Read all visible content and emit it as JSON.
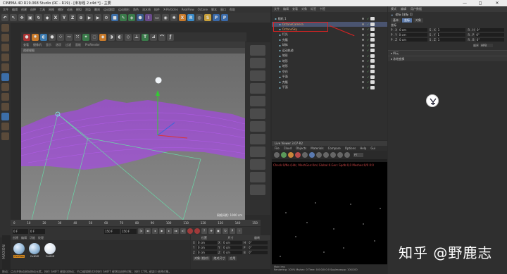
{
  "window": {
    "title": "CINEMA 4D R19.068 Studio (RC - R19) - [未标题 2.c4d *] - 主要",
    "min": "—",
    "max": "◻",
    "close": "✕"
  },
  "menubar": [
    "文件",
    "编辑",
    "创建",
    "选择",
    "工具",
    "网格",
    "捕捉",
    "动画",
    "模拟",
    "渲染",
    "雕刻",
    "运动跟踪",
    "运动图形",
    "角色",
    "流水线",
    "插件",
    "X-Particles",
    "RealFlow",
    "Octane",
    "脚本",
    "窗口",
    "帮助"
  ],
  "toolbar": {
    "axes": [
      "X",
      "Y",
      "Z"
    ],
    "layout_label": "界面:",
    "layout_value": "Octane (用户)"
  },
  "viewport": {
    "menu": [
      "查看",
      "摄像机",
      "显示",
      "选项",
      "过滤",
      "面板",
      "ProRender"
    ],
    "label": "透视视图",
    "grid_scale": "网格间距: 1000 cm"
  },
  "timeline": {
    "ticks": [
      "0",
      "10",
      "20",
      "30",
      "40",
      "50",
      "60",
      "70",
      "80",
      "90",
      "100",
      "110",
      "120",
      "130",
      "140",
      "150"
    ],
    "start": "0 F",
    "start2": "0 F",
    "end": "150 F",
    "end2": "150 F",
    "current": "0 F"
  },
  "materials": {
    "menu": [
      "创建",
      "编辑",
      "功能",
      "纹理"
    ],
    "items": [
      "OctGlos",
      "OctDiff",
      "OctDiff"
    ],
    "brand": "MAXON"
  },
  "coords": {
    "headers": [
      "位置",
      "尺寸",
      "旋转"
    ],
    "rows": [
      {
        "ax": "X",
        "pos": "0 cm",
        "size": "0 cm",
        "rax": "H",
        "rot": "0°"
      },
      {
        "ax": "Y",
        "pos": "0 cm",
        "size": "0 cm",
        "rax": "P",
        "rot": "0°"
      },
      {
        "ax": "Z",
        "pos": "0 cm",
        "size": "0 cm",
        "rax": "B",
        "rot": "0°"
      }
    ],
    "mode": "对象 (相对)",
    "size_mode": "绝对尺寸",
    "apply": "应用"
  },
  "status": "移动：点击并拖动鼠标移动元素，按住 SHIFT 键量化移动；节点编辑模式时按住 SHIFT 键增加选择对象；按住 CTRL 键减少选择对象。",
  "objects": {
    "tabs": [
      "文件",
      "编辑",
      "查看",
      "对象",
      "标签",
      "书签"
    ],
    "hint": "",
    "rows": [
      {
        "name": "随机 1",
        "sel": false,
        "hl": false
      },
      {
        "name": "OctaneCamera",
        "sel": true,
        "hl": true
      },
      {
        "name": "OctaneSky",
        "sel": false,
        "hl": true
      },
      {
        "name": "灯光",
        "sel": false,
        "hl": false
      },
      {
        "name": "克隆",
        "sel": false,
        "hl": false
      },
      {
        "name": "球体",
        "sel": false,
        "hl": false
      },
      {
        "name": "运动轨迹",
        "sel": false,
        "hl": false
      },
      {
        "name": "地形",
        "sel": false,
        "hl": false
      },
      {
        "name": "地形",
        "sel": false,
        "hl": false
      },
      {
        "name": "地形",
        "sel": false,
        "hl": false
      },
      {
        "name": "空白",
        "sel": false,
        "hl": false
      },
      {
        "name": "平面",
        "sel": false,
        "hl": false
      },
      {
        "name": "克隆",
        "sel": false,
        "hl": false
      },
      {
        "name": "平面",
        "sel": false,
        "hl": false
      }
    ]
  },
  "liveviewer": {
    "title": "Live Viewer 3.07-R2",
    "menu": [
      "File",
      "Cloud",
      "Objects",
      "Materials",
      "Compare",
      "Options",
      "Help",
      "Gui"
    ],
    "mode": "PT",
    "error": "Check:0/No (Hdr, MeshGen:0m/  Global:0.Gen: Spdb:0,0 Meshes:0/0  0:0",
    "status1": "Main  ims",
    "status2": "Rendering: 100%   Ms/sec: 0   Time: 0:0:0/0:0:0   Spp/maxspp: 100/100"
  },
  "attributes": {
    "menu": [
      "模式",
      "编辑",
      "用户数据"
    ],
    "sub": [],
    "obj_name": "坐标 [坐标 1]",
    "tabs": [
      "基本",
      "坐标",
      "对象"
    ],
    "section": "坐标",
    "pos": [
      {
        "l": "P . X",
        "v": "0 cm"
      },
      {
        "l": "P . Y",
        "v": "0 cm"
      },
      {
        "l": "P . Z",
        "v": "0 cm"
      }
    ],
    "scale": [
      {
        "l": "S . X",
        "v": "1"
      },
      {
        "l": "S . Y",
        "v": "1"
      },
      {
        "l": "S . Z",
        "v": "1"
      }
    ],
    "rot": [
      {
        "l": "R . H",
        "v": "0°"
      },
      {
        "l": "R . P",
        "v": "0°"
      },
      {
        "l": "R . B",
        "v": "0°"
      }
    ],
    "order_label": "顺序",
    "order_value": "HPB",
    "fold1": "▸ 四元",
    "fold2": "▸ 冻结变换"
  },
  "watermark": "知乎 @野鹿志",
  "colors": {
    "accent": "#d88a1e",
    "selection": "#4a5470",
    "particles": "#b03cff",
    "highlight_box": "#dd2222"
  }
}
